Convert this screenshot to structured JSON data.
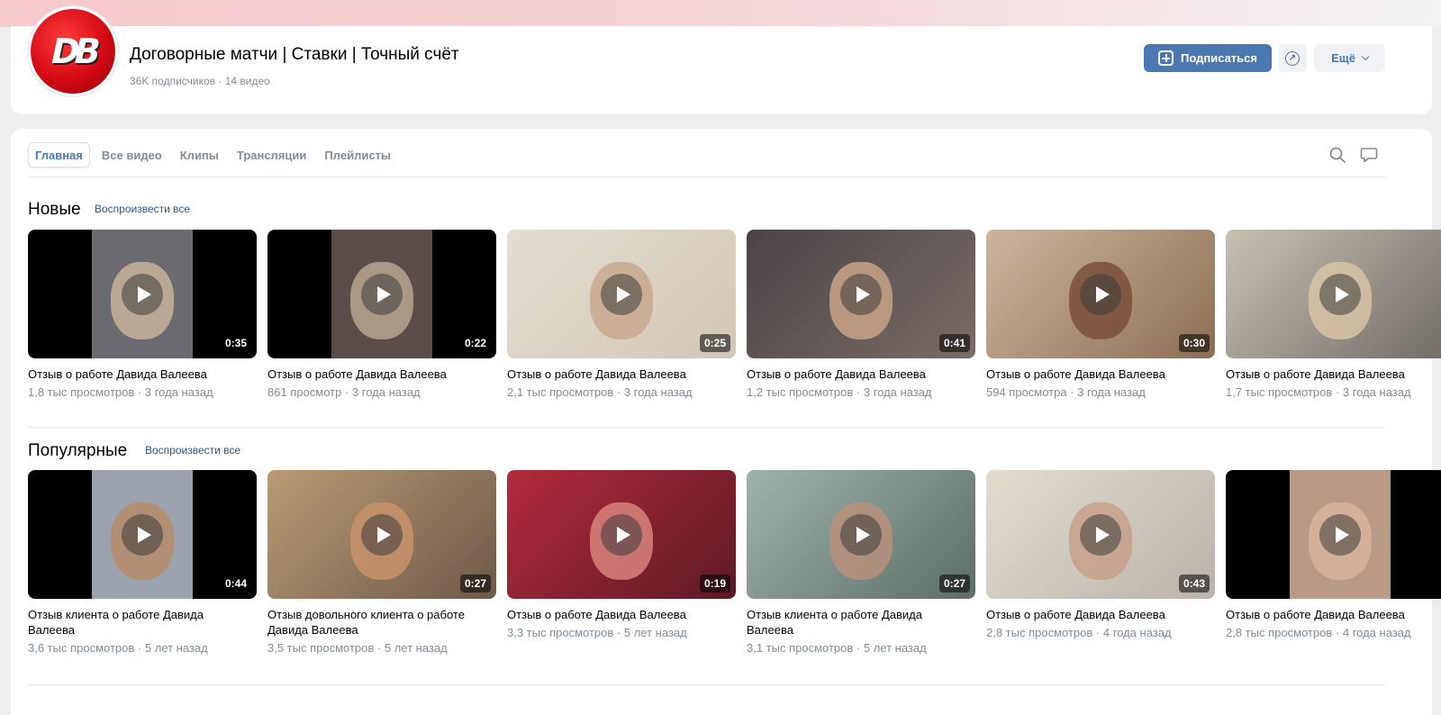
{
  "channel": {
    "logo_text": "DB",
    "title": "Договорные матчи | Ставки | Точный счёт",
    "meta": "36K подписчиков · 14 видео",
    "subscribe_label": "Подписаться",
    "more_label": "Ещё"
  },
  "tabs": [
    {
      "label": "Главная",
      "active": true
    },
    {
      "label": "Все видео",
      "active": false
    },
    {
      "label": "Клипы",
      "active": false
    },
    {
      "label": "Трансляции",
      "active": false
    },
    {
      "label": "Плейлисты",
      "active": false
    }
  ],
  "sections": [
    {
      "title": "Новые",
      "play_all": "Воспроизвести все",
      "videos": [
        {
          "title": "Отзыв о работе Давида Валеева",
          "meta": "1,8 тыс просмотров · 3 года назад",
          "duration": "0:35",
          "colors": [
            "#000000",
            "#6b6a70",
            "#c9b39a"
          ],
          "letterbox": true
        },
        {
          "title": "Отзыв о работе Давида Валеева",
          "meta": "861 просмотр · 3 года назад",
          "duration": "0:22",
          "colors": [
            "#000000",
            "#5b4d4a",
            "#b9a58e"
          ],
          "letterbox": true
        },
        {
          "title": "Отзыв о работе Давида Валеева",
          "meta": "2,1 тыс просмотров · 3 года назад",
          "duration": "0:25",
          "colors": [
            "#e3ddd2",
            "#d2c7b7",
            "#c8a88d"
          ],
          "letterbox": false
        },
        {
          "title": "Отзыв о работе Давида Валеева",
          "meta": "1,2 тыс просмотров · 3 года назад",
          "duration": "0:41",
          "colors": [
            "#4a4347",
            "#7a6d66",
            "#c9a286"
          ],
          "letterbox": false
        },
        {
          "title": "Отзыв о работе Давида Валеева",
          "meta": "594 просмотра · 3 года назад",
          "duration": "0:30",
          "colors": [
            "#cdb59d",
            "#8c6e55",
            "#7a5039"
          ],
          "letterbox": false
        },
        {
          "title": "Отзыв о работе Давида Валеева",
          "meta": "1,7 тыс просмотров · 3 года назад",
          "duration": "",
          "colors": [
            "#c8c1b4",
            "#6f6a65",
            "#d9c3a6"
          ],
          "letterbox": false
        }
      ]
    },
    {
      "title": "Популярные",
      "play_all": "Воспроизвести все",
      "videos": [
        {
          "title": "Отзыв клиента о работе Давида Валеева",
          "meta": "3,6 тыс просмотров · 5 лет назад",
          "duration": "0:44",
          "colors": [
            "#000000",
            "#9aa3ad",
            "#b68b6a"
          ],
          "letterbox": true
        },
        {
          "title": "Отзыв довольного клиента о работе Давида Валеева",
          "meta": "3,5 тыс просмотров · 5 лет назад",
          "duration": "0:27",
          "colors": [
            "#b99a74",
            "#6e5a4a",
            "#c8926b"
          ],
          "letterbox": false
        },
        {
          "title": "Отзыв о работе Давида Валеева",
          "meta": "3,3 тыс просмотров · 5 лет назад",
          "duration": "0:19",
          "colors": [
            "#b42a3d",
            "#5c1a25",
            "#d9827c"
          ],
          "letterbox": false
        },
        {
          "title": "Отзыв клиента о работе Давида Валеева",
          "meta": "3,1 тыс просмотров · 5 лет назад",
          "duration": "0:27",
          "colors": [
            "#9fb3ac",
            "#5d6d68",
            "#b7917a"
          ],
          "letterbox": false
        },
        {
          "title": "Отзыв о работе Давида Валеева",
          "meta": "2,8 тыс просмотров · 4 года назад",
          "duration": "0:43",
          "colors": [
            "#e3dccf",
            "#b9b3ab",
            "#c7a08a"
          ],
          "letterbox": false
        },
        {
          "title": "Отзыв о работе Давида Валеева",
          "meta": "2,8 тыс просмотров · 4 года назад",
          "duration": "",
          "colors": [
            "#000000",
            "#b89a86",
            "#d7b49a"
          ],
          "letterbox": true
        }
      ]
    }
  ]
}
